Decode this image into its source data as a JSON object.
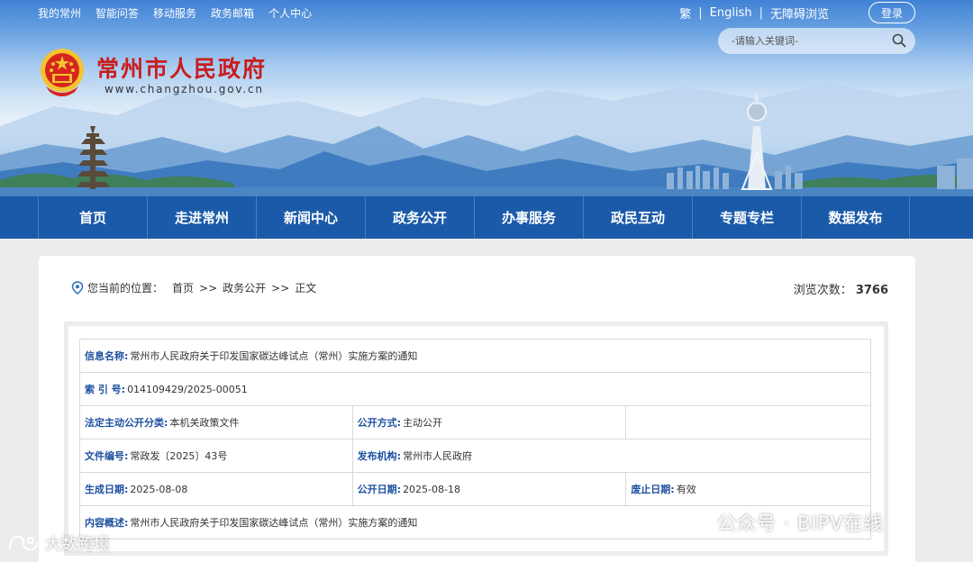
{
  "top_links": [
    "我的常州",
    "智能问答",
    "移动服务",
    "政务邮箱",
    "个人中心"
  ],
  "top_right": {
    "traditional": "繁",
    "english": "English",
    "accessible": "无障碍浏览",
    "login": "登录"
  },
  "search": {
    "placeholder": "-请输入关键词-"
  },
  "site": {
    "title": "常州市人民政府",
    "url": "www.changzhou.gov.cn"
  },
  "main_nav": [
    "首页",
    "走进常州",
    "新闻中心",
    "政务公开",
    "办事服务",
    "政民互动",
    "专题专栏",
    "数据发布"
  ],
  "breadcrumb": {
    "prefix": "您当前的位置：",
    "items": [
      "首页",
      ">>",
      "政务公开",
      ">>",
      "正文"
    ]
  },
  "views": {
    "label": "浏览次数：",
    "count": "3766"
  },
  "info": {
    "name_label": "信息名称:",
    "name_value": "常州市人民政府关于印发国家碳达峰试点（常州）实施方案的通知",
    "index_label": "索 引 号:",
    "index_value": "014109429/2025-00051",
    "category_label": "法定主动公开分类:",
    "category_value": "本机关政策文件",
    "mode_label": "公开方式:",
    "mode_value": "主动公开",
    "docno_label": "文件编号:",
    "docno_value": "常政发〔2025〕43号",
    "issuer_label": "发布机构:",
    "issuer_value": "常州市人民政府",
    "created_label": "生成日期:",
    "created_value": "2025-08-08",
    "published_label": "公开日期:",
    "published_value": "2025-08-18",
    "abolish_label": "废止日期:",
    "abolish_value": "有效",
    "summary_label": "内容概述:",
    "summary_value": "常州市人民政府关于印发国家碳达峰试点（常州）实施方案的通知"
  },
  "watermarks": {
    "right": "公众号 · BIPV在线",
    "left": "大数跨境"
  }
}
